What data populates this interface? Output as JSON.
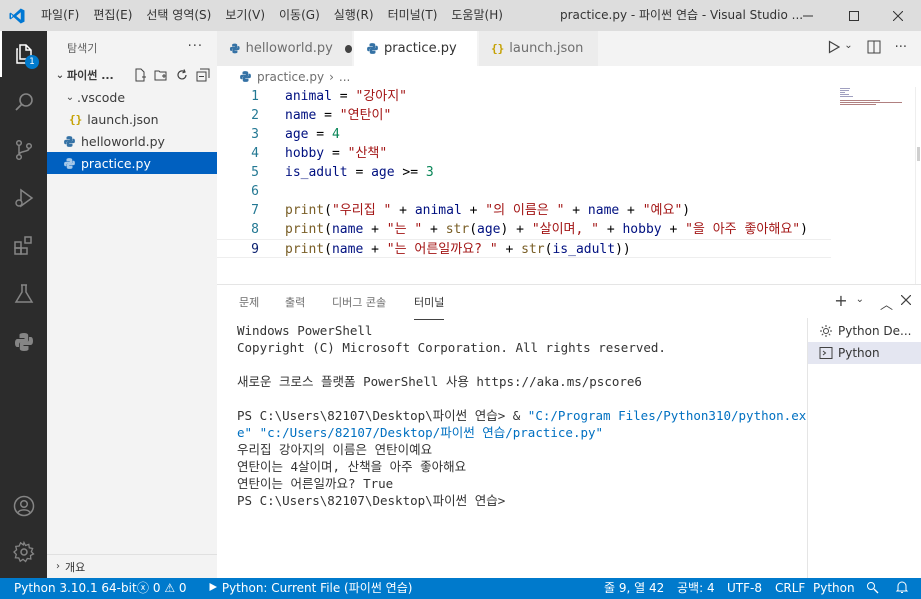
{
  "titlebar": {
    "menu": [
      "파일(F)",
      "편집(E)",
      "선택 영역(S)",
      "보기(V)",
      "이동(G)",
      "실행(R)",
      "터미널(T)",
      "도움말(H)"
    ],
    "window_title": "practice.py - 파이썬 연습 - Visual Studio ..."
  },
  "activity": {
    "explorer_badge": "1"
  },
  "sidebar": {
    "header": "탐색기",
    "folder_name": "파이썬 ...",
    "tree": [
      {
        "label": ".vscode"
      },
      {
        "label": "launch.json"
      },
      {
        "label": "helloworld.py"
      },
      {
        "label": "practice.py"
      }
    ],
    "outline_label": "개요"
  },
  "tabs": [
    {
      "label": "helloworld.py",
      "modified": true
    },
    {
      "label": "practice.py",
      "active": true
    },
    {
      "label": "launch.json"
    }
  ],
  "breadcrumb": {
    "file": "practice.py",
    "tail": "..."
  },
  "editor": {
    "line_numbers": [
      "1",
      "2",
      "3",
      "4",
      "5",
      "6",
      "7",
      "8",
      "9"
    ],
    "lines": [
      "animal = \"강아지\"",
      "name = \"연탄이\"",
      "age = 4",
      "hobby = \"산책\"",
      "is_adult = age >= 3",
      "",
      "print(\"우리집 \" + animal + \"의 이름은 \" + name + \"예요\")",
      "print(name + \"는 \" + str(age) + \"살이며, \" + hobby + \"을 아주 좋아해요\")",
      "print(name + \"는 어른일까요? \" + str(is_adult))"
    ],
    "current_line": 9
  },
  "panel": {
    "tabs": [
      "문제",
      "출력",
      "디버그 콘솔",
      "터미널"
    ],
    "active_tab": "터미널",
    "terminal_lines": [
      "Windows PowerShell",
      "Copyright (C) Microsoft Corporation. All rights reserved.",
      "",
      "새로운 크로스 플랫폼 PowerShell 사용 https://aka.ms/pscore6",
      "",
      "PS C:\\Users\\82107\\Desktop\\파이썬 연습> & ",
      "e\" \"c:/Users/82107/Desktop/파이썬 연습/practice.py\"",
      "우리집 강아지의 이름은 연탄이예요",
      "연탄이는 4살이며, 산책을 아주 좋아해요",
      "연탄이는 어른일까요? True",
      "PS C:\\Users\\82107\\Desktop\\파이썬 연습>"
    ],
    "command_part": "\"C:/Program Files/Python310/python.ex",
    "terminal_list": [
      "Python De...",
      "Python"
    ]
  },
  "statusbar": {
    "python_version": "Python 3.10.1 64-bit",
    "errors": "0",
    "warnings": "0",
    "run_config": "Python: Current File (파이썬 연습)",
    "cursor": "줄 9, 열 42",
    "spaces": "공백: 4",
    "encoding": "UTF-8",
    "eol": "CRLF",
    "language": "Python"
  },
  "colors": {
    "accent": "#007acc",
    "activitybar": "#2c2c2c",
    "sidebar_selected": "#0060c0",
    "string": "#a31515",
    "number": "#098658",
    "function": "#795e26",
    "variable": "#001080"
  }
}
